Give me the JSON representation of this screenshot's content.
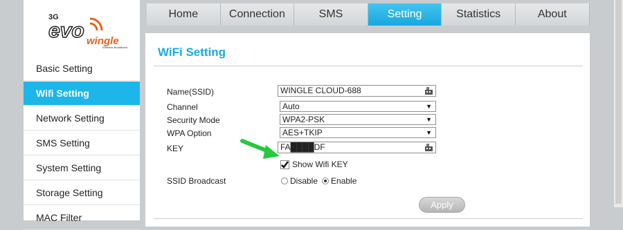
{
  "logo": {
    "prefix": "3G",
    "word": "evo",
    "brand": "wingle",
    "tagline": "Wireless Broadband"
  },
  "sidebar": {
    "items": [
      {
        "label": "Basic Setting",
        "active": false
      },
      {
        "label": "Wifi Setting",
        "active": true
      },
      {
        "label": "Network Setting",
        "active": false
      },
      {
        "label": "SMS Setting",
        "active": false
      },
      {
        "label": "System Setting",
        "active": false
      },
      {
        "label": "Storage Setting",
        "active": false
      },
      {
        "label": "MAC Filter",
        "active": false
      }
    ]
  },
  "topnav": {
    "tabs": [
      {
        "label": "Home",
        "active": false
      },
      {
        "label": "Connection",
        "active": false
      },
      {
        "label": "SMS",
        "active": false
      },
      {
        "label": "Setting",
        "active": true
      },
      {
        "label": "Statistics",
        "active": false
      },
      {
        "label": "About",
        "active": false
      }
    ]
  },
  "main": {
    "title": "WiFi Setting",
    "fields": {
      "ssid": {
        "label": "Name(SSID)",
        "value": "WINGLE CLOUD-688"
      },
      "channel": {
        "label": "Channel",
        "value": "Auto"
      },
      "security_mode": {
        "label": "Security Mode",
        "value": "WPA2-PSK"
      },
      "wpa_option": {
        "label": "WPA Option",
        "value": "AES+TKIP"
      },
      "key": {
        "label": "KEY",
        "value": "FA████DF"
      },
      "show_key": {
        "label": "Show Wifi KEY",
        "checked": true
      },
      "ssid_broadcast": {
        "label": "SSID Broadcast",
        "options": [
          "Disable",
          "Enable"
        ],
        "selected": "Enable"
      }
    },
    "apply_label": "Apply"
  },
  "colors": {
    "accent": "#1cb6e9",
    "title": "#1ba9e0",
    "arrow": "#27c93f"
  }
}
